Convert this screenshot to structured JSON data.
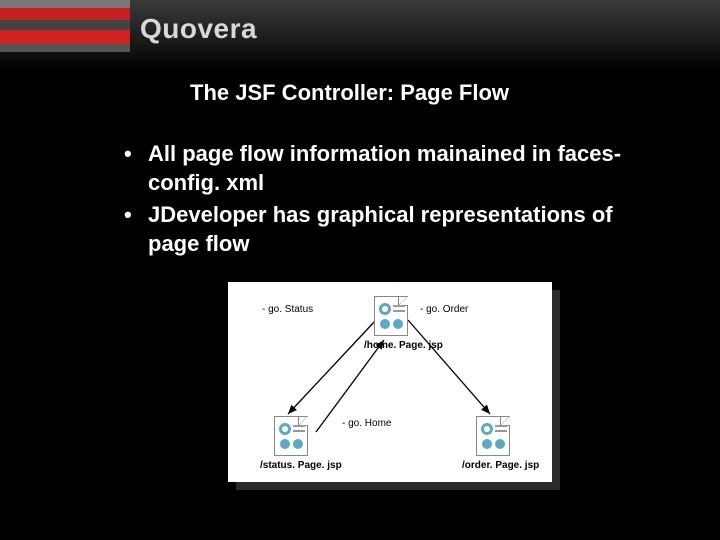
{
  "brand": "Quovera",
  "title": "The JSF Controller: Page Flow",
  "bullets": [
    "All page flow information mainained in faces-config. xml",
    "JDeveloper has graphical representations of page flow"
  ],
  "diagram": {
    "nodes": {
      "home": "/home. Page. jsp",
      "status": "/status. Page. jsp",
      "order": "/order. Page. jsp"
    },
    "arrows": {
      "goStatus": "- go. Status",
      "goOrder": "- go. Order",
      "goHome": "- go. Home"
    }
  }
}
